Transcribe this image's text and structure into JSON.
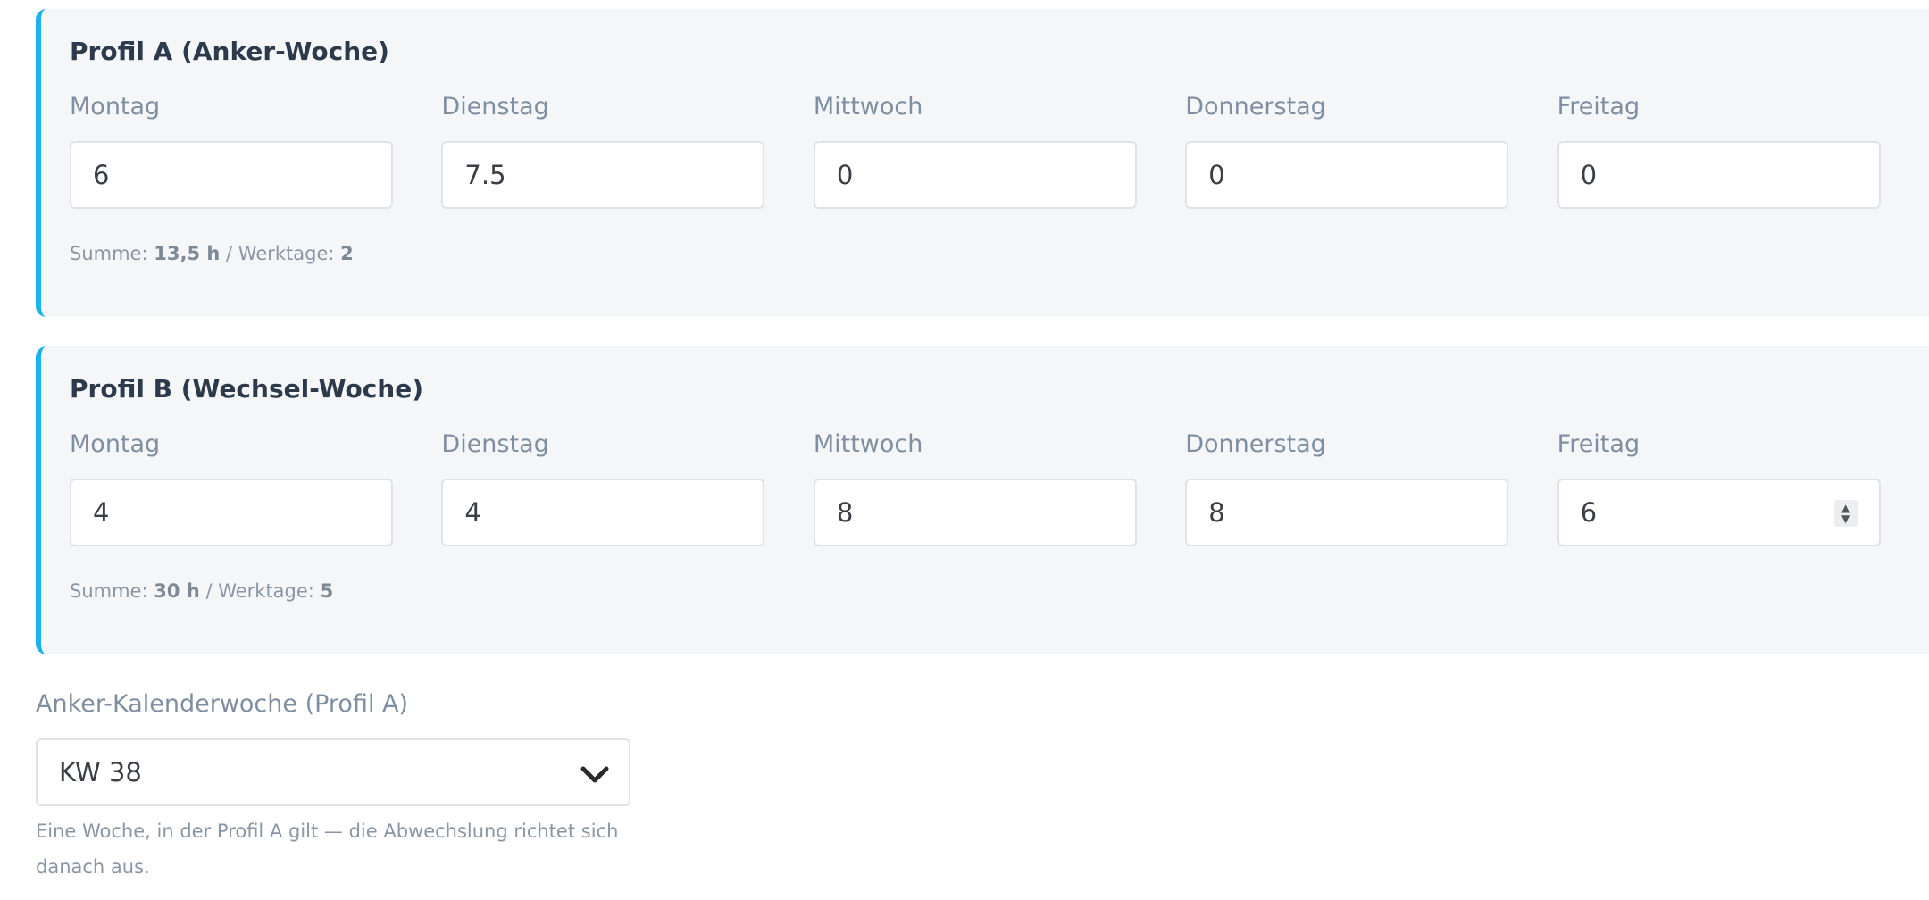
{
  "profile_a": {
    "title": "Profil A (Anker-Woche)",
    "days": [
      {
        "label": "Montag",
        "value": "6"
      },
      {
        "label": "Dienstag",
        "value": "7.5"
      },
      {
        "label": "Mittwoch",
        "value": "0"
      },
      {
        "label": "Donnerstag",
        "value": "0"
      },
      {
        "label": "Freitag",
        "value": "0"
      }
    ],
    "summary": {
      "sum_label": "Summe:",
      "sum_value": "13,5 h",
      "separator": "/",
      "workdays_label": "Werktage:",
      "workdays_value": "2"
    }
  },
  "profile_b": {
    "title": "Profil B (Wechsel-Woche)",
    "days": [
      {
        "label": "Montag",
        "value": "4"
      },
      {
        "label": "Dienstag",
        "value": "4"
      },
      {
        "label": "Mittwoch",
        "value": "8"
      },
      {
        "label": "Donnerstag",
        "value": "8"
      },
      {
        "label": "Freitag",
        "value": "6"
      }
    ],
    "summary": {
      "sum_label": "Summe:",
      "sum_value": "30 h",
      "separator": "/",
      "workdays_label": "Werktage:",
      "workdays_value": "5"
    }
  },
  "anchor": {
    "label": "Anker-Kalenderwoche (Profil A)",
    "selected": "KW 38",
    "help": "Eine Woche, in der Profil A gilt — die Abwechslung richtet sich danach aus."
  },
  "icons": {
    "spinner": "number-spinner-icon",
    "chevron": "chevron-down-icon"
  },
  "colors": {
    "accent": "#1bb2ee",
    "card_bg": "#f4f6f8",
    "title": "#2c3a4b",
    "muted": "#7f8fa1"
  }
}
